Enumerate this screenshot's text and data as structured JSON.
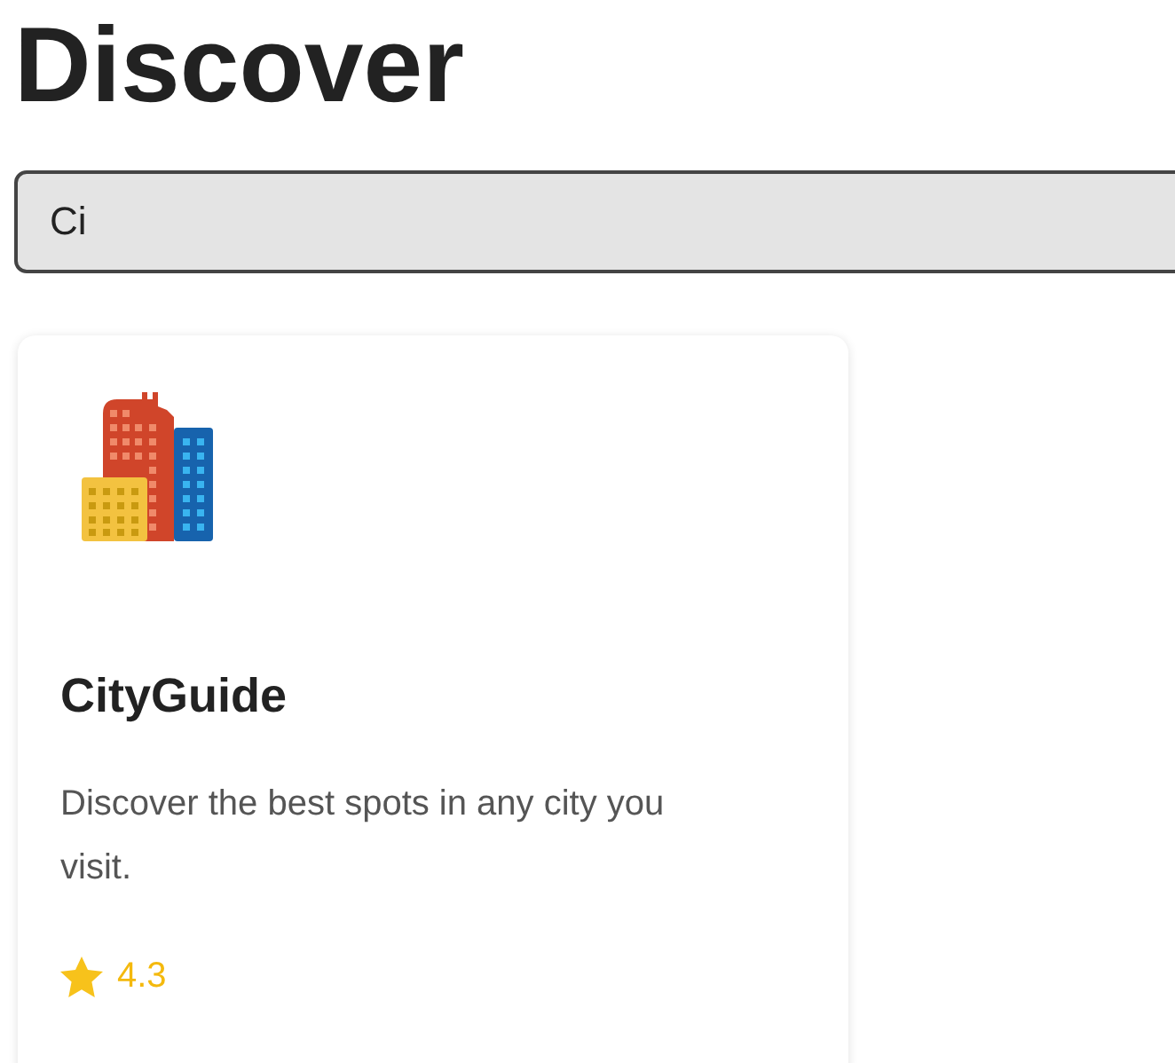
{
  "title": "Discover",
  "search": {
    "value": "Ci"
  },
  "apps": [
    {
      "name": "CityGuide",
      "description": "Discover the best spots in any city you visit.",
      "rating": "4.3"
    }
  ]
}
